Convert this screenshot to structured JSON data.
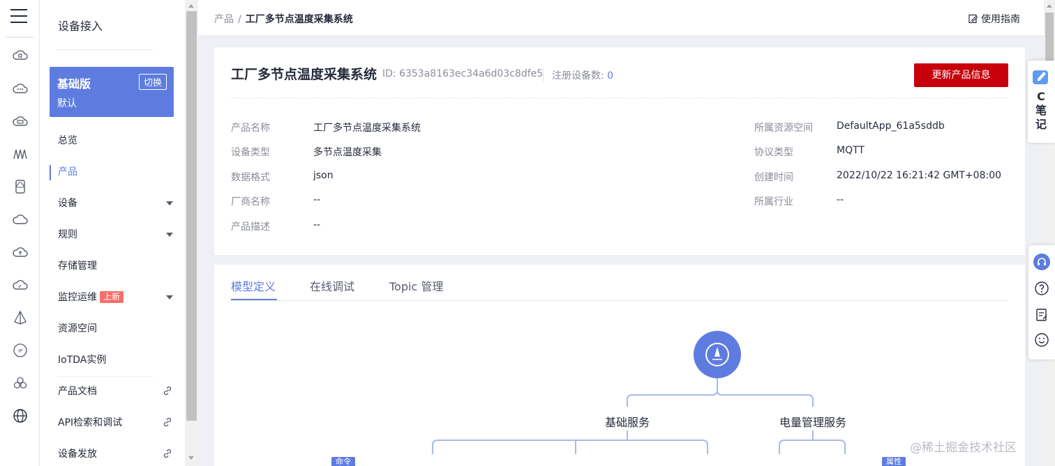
{
  "sidebar": {
    "title": "设备接入",
    "edition": {
      "name": "基础版",
      "sub": "默认",
      "switch_label": "切换"
    },
    "items": [
      {
        "label": "总览"
      },
      {
        "label": "产品"
      },
      {
        "label": "设备"
      },
      {
        "label": "规则"
      },
      {
        "label": "存储管理"
      },
      {
        "label": "监控运维",
        "badge": "上新"
      },
      {
        "label": "资源空间"
      },
      {
        "label": "IoTDA实例"
      },
      {
        "label": "产品文档"
      },
      {
        "label": "API检索和调试"
      },
      {
        "label": "设备发放"
      }
    ]
  },
  "header": {
    "breadcrumb": {
      "parent": "产品",
      "sep": "/",
      "current": "工厂多节点温度采集系统"
    },
    "guide_label": "使用指南"
  },
  "product": {
    "title": "工厂多节点温度采集系统",
    "id_text": "ID: 6353a8163ec34a6d03c8dfe5",
    "count_label": "注册设备数:",
    "count_value": "0",
    "update_button": "更新产品信息",
    "fields_left": [
      {
        "label": "产品名称",
        "value": "工厂多节点温度采集系统"
      },
      {
        "label": "设备类型",
        "value": "多节点温度采集"
      },
      {
        "label": "数据格式",
        "value": "json"
      },
      {
        "label": "厂商名称",
        "value": "--"
      },
      {
        "label": "产品描述",
        "value": "--"
      }
    ],
    "fields_right": [
      {
        "label": "所属资源空间",
        "value": "DefaultApp_61a5sddb"
      },
      {
        "label": "协议类型",
        "value": "MQTT"
      },
      {
        "label": "创建时间",
        "value": "2022/10/22 16:21:42 GMT+08:00"
      },
      {
        "label": "所属行业",
        "value": "--"
      }
    ]
  },
  "model": {
    "tabs": [
      {
        "label": "模型定义"
      },
      {
        "label": "在线调试"
      },
      {
        "label": "Topic 管理"
      }
    ],
    "services": [
      {
        "name": "基础服务"
      },
      {
        "name": "电量管理服务"
      }
    ],
    "tags": [
      {
        "label": "命令"
      },
      {
        "label": "属性"
      }
    ]
  },
  "floating": {
    "note_text": "C笔记"
  },
  "watermark": "@稀土掘金技术社区",
  "colors": {
    "accent": "#5e7ce0",
    "danger": "#c7000b",
    "badge": "#f66f6a"
  }
}
